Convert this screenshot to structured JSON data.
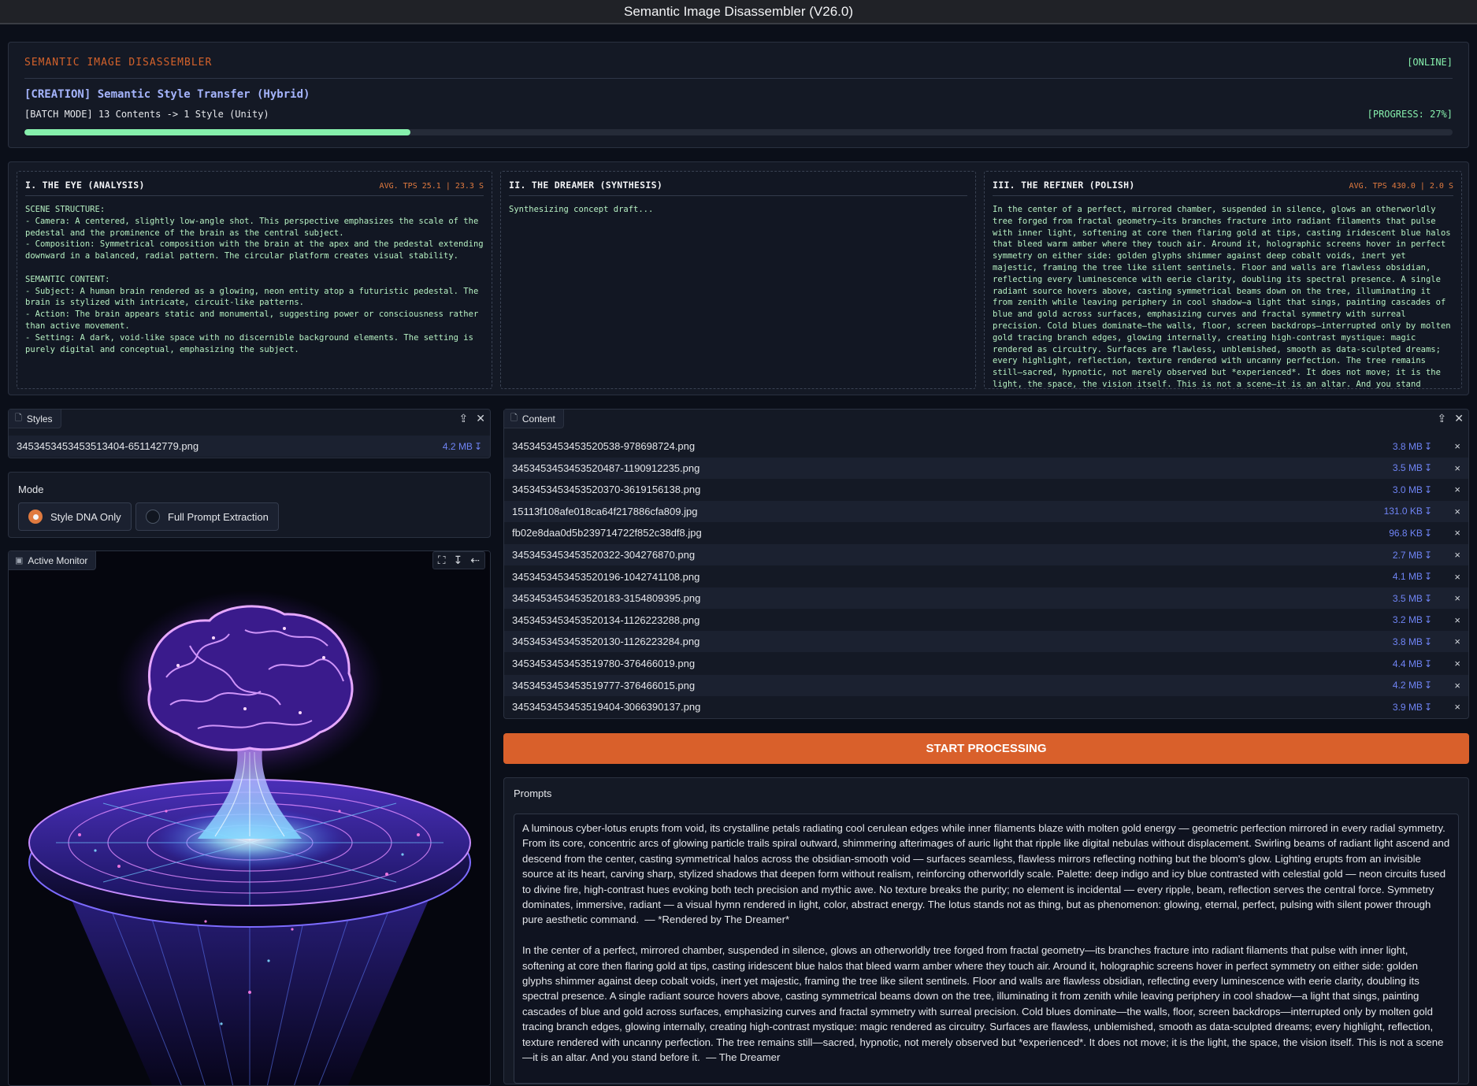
{
  "window": {
    "title": "Semantic Image Disassembler (V26.0)"
  },
  "header": {
    "brand": "SEMANTIC IMAGE DISASSEMBLER",
    "status": "[ONLINE]",
    "mode_title": "[CREATION] Semantic Style Transfer (Hybrid)",
    "batch_info": "[BATCH MODE] 13 Contents -> 1 Style (Unity)",
    "progress_label": "[PROGRESS: 27%]",
    "progress_fraction": 0.27
  },
  "stages": [
    {
      "title": "I. THE EYE (ANALYSIS)",
      "stats": "AVG. TPS 25.1 | 23.3 S",
      "body": "SCENE STRUCTURE:\n- Camera: A centered, slightly low-angle shot. This perspective emphasizes the scale of the pedestal and the prominence of the brain as the central subject.\n- Composition: Symmetrical composition with the brain at the apex and the pedestal extending downward in a balanced, radial pattern. The circular platform creates visual stability.\n\nSEMANTIC CONTENT:\n- Subject: A human brain rendered as a glowing, neon entity atop a futuristic pedestal. The brain is stylized with intricate, circuit-like patterns.\n- Action: The brain appears static and monumental, suggesting power or consciousness rather than active movement.\n- Setting: A dark, void-like space with no discernible background elements. The setting is purely digital and conceptual, emphasizing the subject."
    },
    {
      "title": "II. THE DREAMER (SYNTHESIS)",
      "stats": "",
      "body": "Synthesizing concept draft..."
    },
    {
      "title": "III. THE REFINER (POLISH)",
      "stats": "AVG. TPS 430.0 | 2.0 S",
      "body": "In the center of a perfect, mirrored chamber, suspended in silence, glows an otherworldly tree forged from fractal geometry—its branches fracture into radiant filaments that pulse with inner light, softening at core then flaring gold at tips, casting iridescent blue halos that bleed warm amber where they touch air. Around it, holographic screens hover in perfect symmetry on either side: golden glyphs shimmer against deep cobalt voids, inert yet majestic, framing the tree like silent sentinels. Floor and walls are flawless obsidian, reflecting every luminescence with eerie clarity, doubling its spectral presence. A single radiant source hovers above, casting symmetrical beams down on the tree, illuminating it from zenith while leaving periphery in cool shadow—a light that sings, painting cascades of blue and gold across surfaces, emphasizing curves and fractal symmetry with surreal precision. Cold blues dominate—the walls, floor, screen backdrops—interrupted only by molten gold tracing branch edges, glowing internally, creating high-contrast mystique: magic rendered as circuitry. Surfaces are flawless, unblemished, smooth as data-sculpted dreams; every highlight, reflection, texture rendered with uncanny perfection. The tree remains still—sacred, hypnotic, not merely observed but *experienced*. It does not move; it is the light, the space, the vision itself. This is not a scene—it is an altar. And you stand before it.  — The Dreamer"
    }
  ],
  "styles": {
    "label": "Styles",
    "files": [
      {
        "name": "3453453453453513404-651142779.png",
        "size": "4.2 MB"
      }
    ]
  },
  "mode": {
    "label": "Mode",
    "options": [
      {
        "label": "Style DNA Only",
        "selected": true
      },
      {
        "label": "Full Prompt Extraction",
        "selected": false
      }
    ]
  },
  "monitor": {
    "label": "Active Monitor"
  },
  "content": {
    "label": "Content",
    "files": [
      {
        "name": "3453453453453520538-978698724.png",
        "size": "3.8 MB"
      },
      {
        "name": "3453453453453520487-1190912235.png",
        "size": "3.5 MB"
      },
      {
        "name": "3453453453453520370-3619156138.png",
        "size": "3.0 MB"
      },
      {
        "name": "15113f108afe018ca64f217886cfa809.jpg",
        "size": "131.0 KB"
      },
      {
        "name": "fb02e8daa0d5b239714722f852c38df8.jpg",
        "size": "96.8 KB"
      },
      {
        "name": "3453453453453520322-304276870.png",
        "size": "2.7 MB"
      },
      {
        "name": "3453453453453520196-1042741108.png",
        "size": "4.1 MB"
      },
      {
        "name": "3453453453453520183-3154809395.png",
        "size": "3.5 MB"
      },
      {
        "name": "3453453453453520134-1126223288.png",
        "size": "3.2 MB"
      },
      {
        "name": "3453453453453520130-1126223284.png",
        "size": "3.8 MB"
      },
      {
        "name": "3453453453453519780-376466019.png",
        "size": "4.4 MB"
      },
      {
        "name": "3453453453453519777-376466015.png",
        "size": "4.2 MB"
      },
      {
        "name": "3453453453453519404-3066390137.png",
        "size": "3.9 MB"
      }
    ]
  },
  "actions": {
    "start_label": "START PROCESSING"
  },
  "prompts": {
    "label": "Prompts",
    "text": "A luminous cyber-lotus erupts from void, its crystalline petals radiating cool cerulean edges while inner filaments blaze with molten gold energy — geometric perfection mirrored in every radial symmetry. From its core, concentric arcs of glowing particle trails spiral outward, shimmering afterimages of auric light that ripple like digital nebulas without displacement. Swirling beams of radiant light ascend and descend from the center, casting symmetrical halos across the obsidian-smooth void — surfaces seamless, flawless mirrors reflecting nothing but the bloom's glow. Lighting erupts from an invisible source at its heart, carving sharp, stylized shadows that deepen form without realism, reinforcing otherworldly scale. Palette: deep indigo and icy blue contrasted with celestial gold — neon circuits fused to divine fire, high-contrast hues evoking both tech precision and mythic awe. No texture breaks the purity; no element is incidental — every ripple, beam, reflection serves the central force. Symmetry dominates, immersive, radiant — a visual hymn rendered in light, color, abstract energy. The lotus stands not as thing, but as phenomenon: glowing, eternal, perfect, pulsing with silent power through pure aesthetic command.  — *Rendered by The Dreamer*\n\nIn the center of a perfect, mirrored chamber, suspended in silence, glows an otherworldly tree forged from fractal geometry—its branches fracture into radiant filaments that pulse with inner light, softening at core then flaring gold at tips, casting iridescent blue halos that bleed warm amber where they touch air. Around it, holographic screens hover in perfect symmetry on either side: golden glyphs shimmer against deep cobalt voids, inert yet majestic, framing the tree like silent sentinels. Floor and walls are flawless obsidian, reflecting every luminescence with eerie clarity, doubling its spectral presence. A single radiant source hovers above, casting symmetrical beams down on the tree, illuminating it from zenith while leaving periphery in cool shadow—a light that sings, painting cascades of blue and gold across surfaces, emphasizing curves and fractal symmetry with surreal precision. Cold blues dominate—the walls, floor, screen backdrops—interrupted only by molten gold tracing branch edges, glowing internally, creating high-contrast mystique: magic rendered as circuitry. Surfaces are flawless, unblemished, smooth as data-sculpted dreams; every highlight, reflection, texture rendered with uncanny perfection. The tree remains still—sacred, hypnotic, not merely observed but *experienced*. It does not move; it is the light, the space, the vision itself. This is not a scene—it is an altar. And you stand before it.  — The Dreamer"
  },
  "icons": {
    "file": "file-icon",
    "upload": "upload-icon",
    "close": "close-icon",
    "download": "download-icon",
    "fullscreen": "fullscreen-icon",
    "share": "share-icon",
    "image": "image-icon"
  },
  "colors": {
    "accent": "#d9602b",
    "success": "#86efac",
    "link": "#6f84f5",
    "background": "#0b0f19"
  }
}
